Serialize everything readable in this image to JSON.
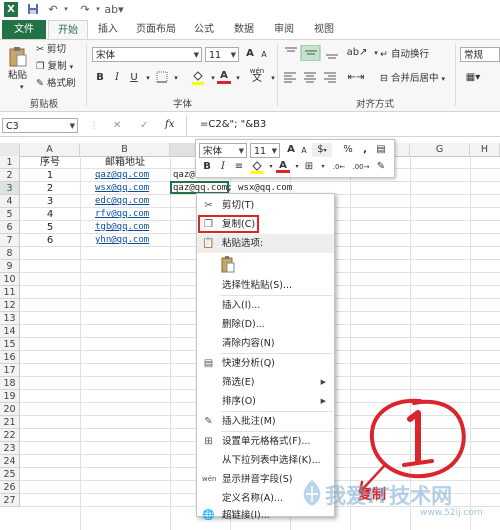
{
  "qat": {
    "undo_icon": "undo-icon",
    "redo_icon": "redo-icon",
    "save_icon": "save-icon",
    "logo_text": "X"
  },
  "tabs": [
    "文件",
    "开始",
    "插入",
    "页面布局",
    "公式",
    "数据",
    "审阅",
    "视图"
  ],
  "ribbon": {
    "clipboard": {
      "paste": "粘贴",
      "cut": "剪切",
      "copy": "复制",
      "format_painter": "格式刷",
      "label": "剪贴板"
    },
    "font": {
      "name": "宋体",
      "size": "11",
      "bold": "B",
      "italic": "I",
      "underline": "U",
      "grow": "A",
      "shrink": "A",
      "label": "字体",
      "wen": "wén",
      "wen_char": "文"
    },
    "align": {
      "wrap": "自动换行",
      "merge": "合并后居中",
      "label": "对齐方式"
    },
    "number": {
      "format": "常规"
    }
  },
  "formula_bar": {
    "name_box": "C3",
    "cancel": "✕",
    "enter": "✓",
    "fx": "fx",
    "formula": "=C2&\"; \"&B3"
  },
  "columns": [
    "A",
    "B",
    "C",
    "D",
    "E",
    "F",
    "G",
    "H"
  ],
  "rows": [
    "1",
    "2",
    "3",
    "4",
    "5",
    "6",
    "7",
    "8",
    "9",
    "10",
    "11",
    "12",
    "13",
    "14",
    "15",
    "16",
    "17",
    "18",
    "19",
    "20",
    "21",
    "22",
    "23",
    "24",
    "25",
    "26",
    "27"
  ],
  "sheet": {
    "header_a": "序号",
    "header_b": "邮箱地址",
    "a": [
      "1",
      "2",
      "3",
      "4",
      "5",
      "6"
    ],
    "b": [
      "qaz@qq.com",
      "wsx@qq.com",
      "edc@qq.com",
      "rfv@qq.com",
      "tgb@qq.com",
      "yhn@qq.com"
    ],
    "c2": "qaz@",
    "c3": "qaz@qq.com; wsx@qq.com"
  },
  "mini_toolbar": {
    "font": "宋体",
    "size": "11",
    "grow": "A",
    "shrink": "A",
    "currency": "$",
    "percent": "%",
    "comma": ",",
    "bold": "B",
    "italic": "I",
    "wen": "wén"
  },
  "menu": {
    "cut": "剪切(T)",
    "copy": "复制(C)",
    "paste_options": "粘贴选项:",
    "paste_special": "选择性粘贴(S)...",
    "insert": "插入(I)...",
    "delete": "删除(D)...",
    "clear": "清除内容(N)",
    "quick_analysis": "快速分析(Q)",
    "filter": "筛选(E)",
    "sort": "排序(O)",
    "insert_comment": "插入批注(M)",
    "format_cells": "设置单元格格式(F)...",
    "dropdown_pick": "从下拉列表中选择(K)...",
    "phonetic": "显示拼音字段(S)",
    "define_name": "定义名称(A)...",
    "hyperlink": "超链接(I)..."
  },
  "annotation": {
    "circle_text": "①",
    "label": "复制",
    "watermark": "我爱IT技术网",
    "watermark_sub": "www.52ij.com"
  },
  "colors": {
    "excel_green": "#217346",
    "annotation_red": "#d9252b",
    "link_blue": "#0b4f9c"
  }
}
